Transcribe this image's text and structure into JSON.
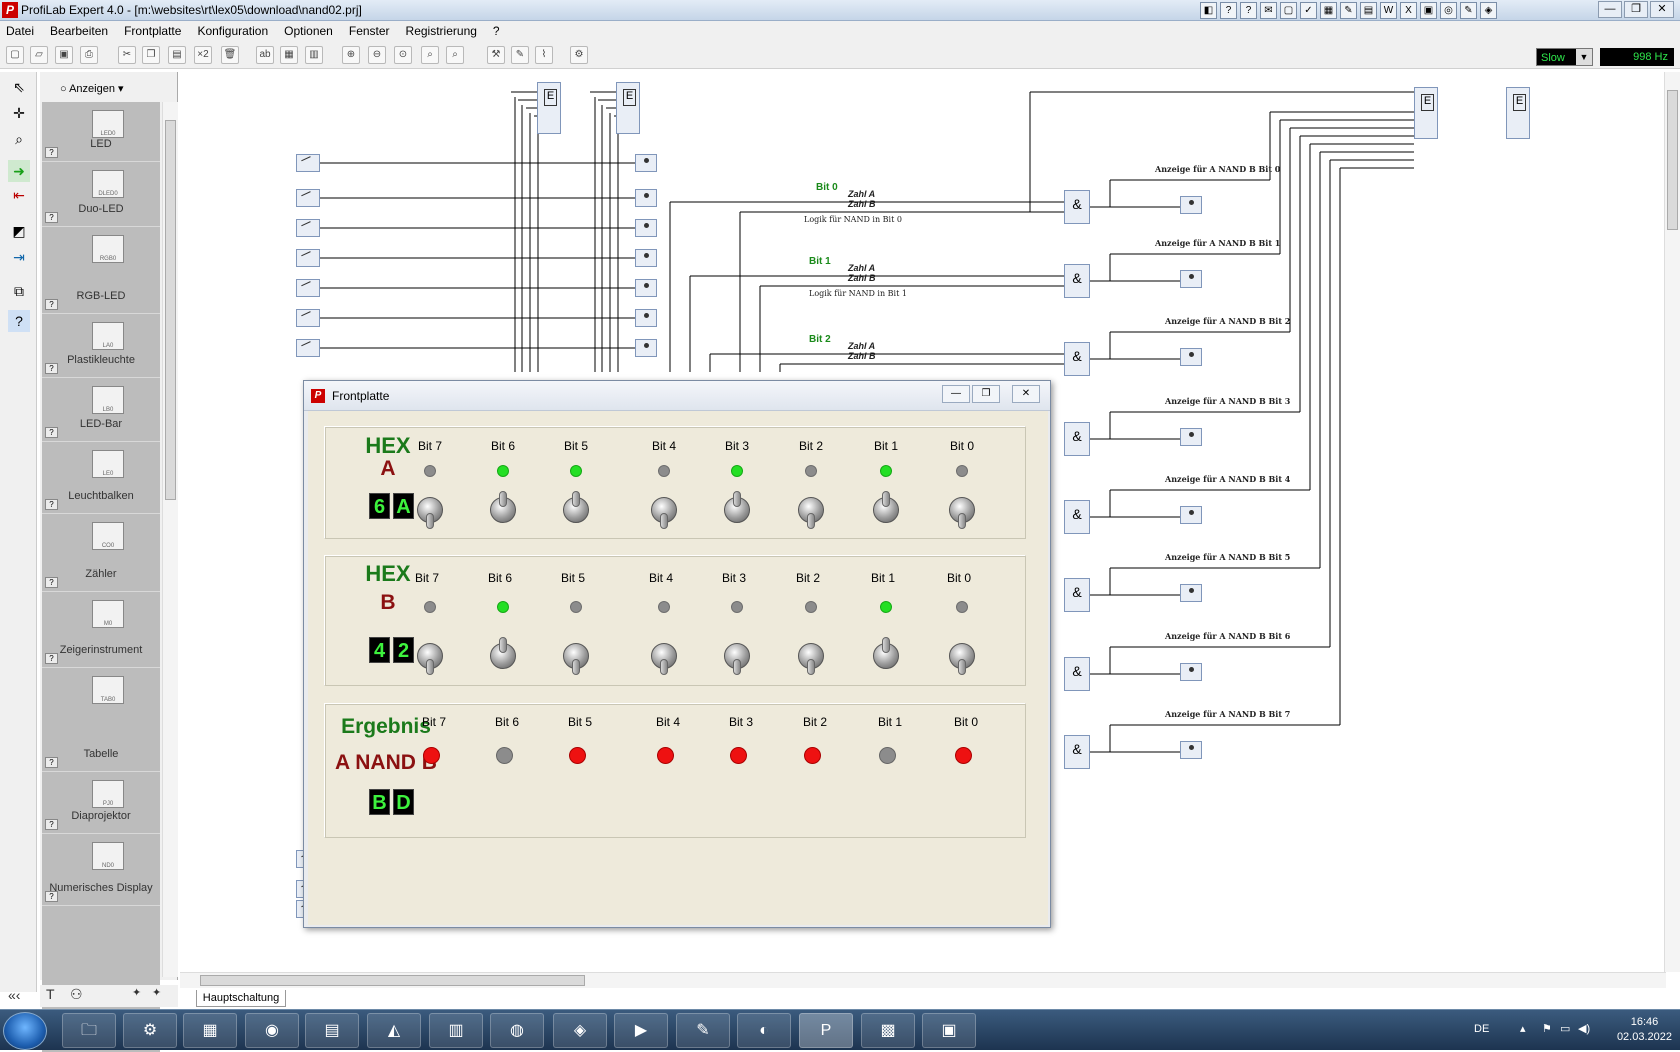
{
  "window": {
    "title": "ProfiLab Expert 4.0 - [m:\\websites\\rt\\lex05\\download\\nand02.prj]"
  },
  "menu": [
    "Datei",
    "Bearbeiten",
    "Frontplatte",
    "Konfiguration",
    "Optionen",
    "Fenster",
    "Registrierung",
    "?"
  ],
  "toolbar": {
    "speed": "Slow",
    "frequency": "998 Hz",
    "x2_label": "×2"
  },
  "palette": {
    "header": "Anzeigen",
    "items": [
      {
        "label": "LED",
        "code": "LED0"
      },
      {
        "label": "Duo-LED",
        "code": "DLED0"
      },
      {
        "label": "RGB-LED",
        "code": "RGB0"
      },
      {
        "label": "Plastikleuchte",
        "code": "LA0"
      },
      {
        "label": "LED-Bar",
        "code": "LB0"
      },
      {
        "label": "Leuchtbalken",
        "code": "LE0"
      },
      {
        "label": "Zähler",
        "code": "CO0"
      },
      {
        "label": "Zeigerinstrument",
        "code": "M0"
      },
      {
        "label": "Tabelle",
        "code": "TAB0"
      },
      {
        "label": "Diaprojektor",
        "code": "PJ0"
      },
      {
        "label": "Numerisches Display",
        "code": "ND0"
      }
    ]
  },
  "sheet_tab": "Hauptschaltung",
  "circuit": {
    "bits": [
      "Bit 0",
      "Bit 1",
      "Bit 2"
    ],
    "input_a": "Zahl A",
    "input_b": "Zahl B",
    "logic_labels": [
      "Logik für NAND in Bit 0",
      "Logik für NAND in Bit 1"
    ],
    "gate_symbol": "&",
    "outputs": [
      "Anzeige für A NAND B Bit 0",
      "Anzeige für A NAND B Bit 1",
      "Anzeige für A NAND B Bit 2",
      "Anzeige für A NAND B Bit 3",
      "Anzeige für A NAND B Bit 4",
      "Anzeige für A NAND B Bit 5",
      "Anzeige für A NAND B Bit 6",
      "Anzeige für A NAND B Bit 7"
    ],
    "hex_label": "HEX"
  },
  "frontpanel": {
    "title": "Frontplatte",
    "bit_labels": [
      "Bit 7",
      "Bit 6",
      "Bit 5",
      "Bit 4",
      "Bit 3",
      "Bit 2",
      "Bit 1",
      "Bit 0"
    ],
    "group_a": {
      "title1": "HEX",
      "title2": "A",
      "hex": [
        "6",
        "A"
      ],
      "bits": [
        0,
        1,
        1,
        0,
        1,
        0,
        1,
        0
      ]
    },
    "group_b": {
      "title1": "HEX",
      "title2": "B",
      "hex": [
        "4",
        "2"
      ],
      "bits": [
        0,
        1,
        0,
        0,
        0,
        0,
        1,
        0
      ]
    },
    "result": {
      "title1": "Ergebnis",
      "title2": "A NAND B",
      "hex": [
        "B",
        "D"
      ],
      "bits": [
        1,
        0,
        1,
        1,
        1,
        1,
        0,
        1
      ]
    }
  },
  "taskbar": {
    "lang": "DE",
    "time": "16:46",
    "date": "02.03.2022"
  },
  "colors": {
    "led_on": "#24df24",
    "led_red": "#ee1111",
    "hex_green": "#3df23d",
    "title_green": "#1b7a1b",
    "title_red": "#8b1111"
  }
}
